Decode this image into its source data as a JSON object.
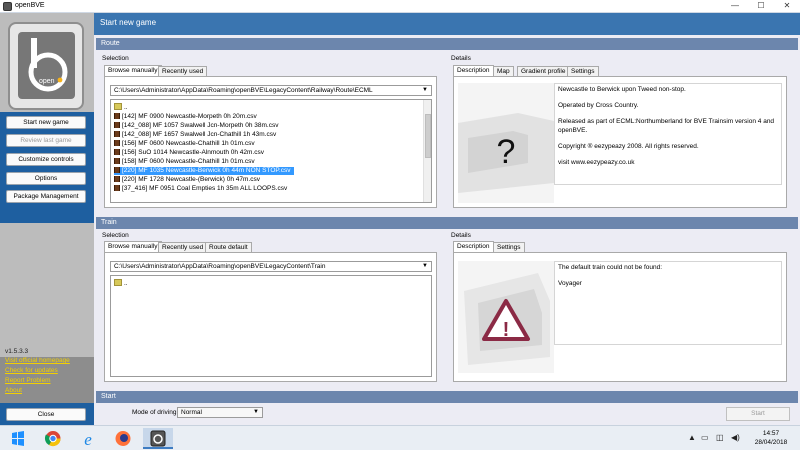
{
  "window": {
    "title": "openBVE",
    "minimize": "—",
    "maximize": "☐",
    "close": "✕"
  },
  "sidebar": {
    "logo_text": "open",
    "buttons": [
      {
        "label": "Start new game",
        "disabled": false
      },
      {
        "label": "Review last game",
        "disabled": true
      },
      {
        "label": "Customize controls",
        "disabled": false
      },
      {
        "label": "Options",
        "disabled": false
      },
      {
        "label": "Package Management",
        "disabled": false
      }
    ],
    "version": "v1.5.3.3",
    "links": [
      "Visit official homepage",
      "Check for updates",
      "Report Problem",
      "About"
    ],
    "close_label": "Close"
  },
  "main": {
    "header": "Start new game",
    "route": {
      "section": "Route",
      "selection_label": "Selection",
      "tabs": [
        "Browse manually",
        "Recently used"
      ],
      "path": "C:\\Users\\Administrator\\AppData\\Roaming\\openBVE\\LegacyContent\\Railway\\Route\\ECML",
      "up_item": "..",
      "items": [
        "[142] MF 0900 Newcastle-Morpeth 0h 20m.csv",
        "[142_088] MF 1057 Swalwell Jcn-Morpeth 0h 38m.csv",
        "[142_088] MF 1657 Swalwell Jcn-Chathill 1h 43m.csv",
        "[156] MF 0600 Newcastle-Chathill 1h 01m.csv",
        "[156] SuO 1014 Newcastle-Alnmouth 0h 42m.csv",
        "[158] MF 0600 Newcastle-Chathill 1h 01m.csv",
        "[220] MF 1035 Newcastle-Berwick 0h 44m NON STOP.csv",
        "[220] MF 1728 Newcastle-(Berwick) 0h 47m.csv",
        "[37_416] MF 0951 Coal Empties 1h 35m ALL LOOPS.csv"
      ],
      "selected_index": 6,
      "details_label": "Details",
      "details_tabs": [
        "Description",
        "Map",
        "Gradient profile",
        "Settings"
      ],
      "preview_glyph": "?",
      "description": [
        "Newcastle to Berwick upon Tweed non-stop.",
        "Operated by Cross Country.",
        "Released as part of ECML:Northumberland for BVE Trainsim version 4 and openBVE.",
        "Copyright ® eezypeazy 2008. All rights reserved.",
        "visit www.eezypeazy.co.uk"
      ]
    },
    "train": {
      "section": "Train",
      "selection_label": "Selection",
      "tabs": [
        "Browse manually",
        "Recently used",
        "Route default"
      ],
      "path": "C:\\Users\\Administrator\\AppData\\Roaming\\openBVE\\LegacyContent\\Train",
      "up_item": "..",
      "details_label": "Details",
      "details_tabs": [
        "Description",
        "Settings"
      ],
      "preview_glyph": "!",
      "description": [
        "The default train could not be found:",
        "Voyager"
      ]
    },
    "start": {
      "section": "Start",
      "mode_label": "Mode of driving:",
      "mode_value": "Normal",
      "start_label": "Start"
    }
  },
  "taskbar": {
    "time": "14:57",
    "date": "28/04/2018"
  },
  "colors": {
    "header_blue": "#3a75b0",
    "section_bar": "#6c86ad",
    "sidebar_blue": "#1e5fa0",
    "link_yellow": "#f2d000",
    "selection": "#3399ff"
  }
}
